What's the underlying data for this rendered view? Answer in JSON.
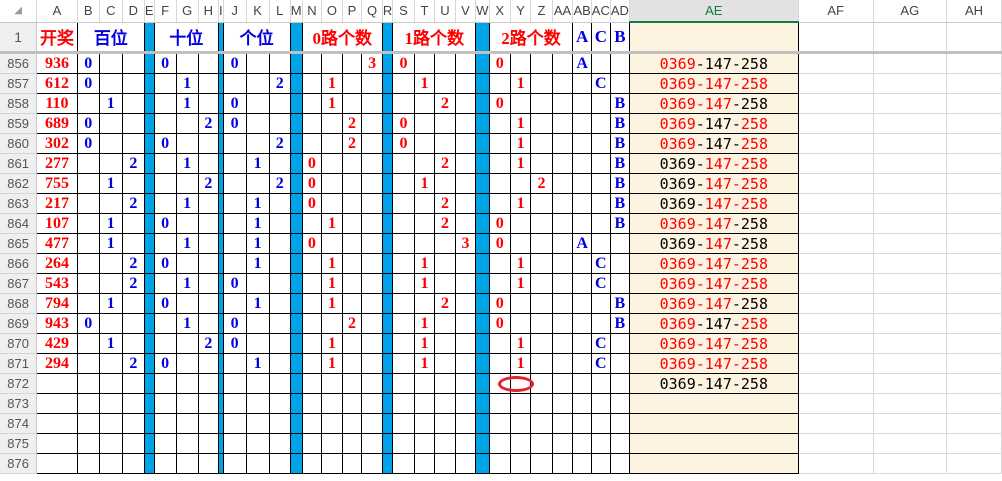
{
  "columns": [
    "A",
    "B",
    "C",
    "D",
    "E",
    "F",
    "G",
    "H",
    "I",
    "J",
    "K",
    "L",
    "M",
    "N",
    "O",
    "P",
    "Q",
    "R",
    "S",
    "T",
    "U",
    "V",
    "W",
    "X",
    "Y",
    "Z",
    "AA",
    "AB",
    "AC",
    "AD",
    "AE",
    "AF",
    "AG",
    "AH"
  ],
  "header_row": {
    "row": "1",
    "kaijiang": "开奖",
    "bai": "百位",
    "shi": "十位",
    "ge": "个位",
    "lu0": "0路个数",
    "lu1": "1路个数",
    "lu2": "2路个数",
    "ab": "A",
    "ac": "C",
    "ad": "B"
  },
  "ae_sep": "-",
  "rows": [
    {
      "row": "856",
      "a": "936",
      "cells": [
        "0",
        "",
        "",
        "0",
        "",
        "",
        "0",
        "",
        "",
        "",
        "",
        "",
        "3",
        "0",
        "",
        "",
        "",
        "0",
        "",
        "",
        "",
        "A",
        "",
        ""
      ],
      "ae_parts": [
        "0369",
        "147",
        "258"
      ],
      "ae_red": [
        1,
        0,
        0
      ]
    },
    {
      "row": "857",
      "a": "612",
      "cells": [
        "0",
        "",
        "",
        "",
        "1",
        "",
        "",
        "",
        "2",
        "",
        "1",
        "",
        "",
        "",
        "1",
        "",
        "",
        "",
        "1",
        "",
        "",
        "",
        "C",
        ""
      ],
      "ae_parts": [
        "0369",
        "147",
        "258"
      ],
      "ae_red": [
        1,
        1,
        1
      ]
    },
    {
      "row": "858",
      "a": "110",
      "cells": [
        "",
        "1",
        "",
        "",
        "1",
        "",
        "0",
        "",
        "",
        "",
        "1",
        "",
        "",
        "",
        "",
        "2",
        "",
        "0",
        "",
        "",
        "",
        "",
        "",
        "B"
      ],
      "ae_parts": [
        "0369",
        "147",
        "258"
      ],
      "ae_red": [
        1,
        1,
        0
      ]
    },
    {
      "row": "859",
      "a": "689",
      "cells": [
        "0",
        "",
        "",
        "",
        "",
        "2",
        "0",
        "",
        "",
        "",
        "",
        "2",
        "",
        "0",
        "",
        "",
        "",
        "",
        "1",
        "",
        "",
        "",
        "",
        "B"
      ],
      "ae_parts": [
        "0369",
        "147",
        "258"
      ],
      "ae_red": [
        1,
        0,
        1
      ]
    },
    {
      "row": "860",
      "a": "302",
      "cells": [
        "0",
        "",
        "",
        "0",
        "",
        "",
        "",
        "",
        "2",
        "",
        "",
        "2",
        "",
        "0",
        "",
        "",
        "",
        "",
        "1",
        "",
        "",
        "",
        "",
        "B"
      ],
      "ae_parts": [
        "0369",
        "147",
        "258"
      ],
      "ae_red": [
        1,
        0,
        1
      ]
    },
    {
      "row": "861",
      "a": "277",
      "cells": [
        "",
        "",
        "2",
        "",
        "1",
        "",
        "",
        "1",
        "",
        "0",
        "",
        "",
        "",
        "",
        "",
        "2",
        "",
        "",
        "1",
        "",
        "",
        "",
        "",
        "B"
      ],
      "ae_parts": [
        "0369",
        "147",
        "258"
      ],
      "ae_red": [
        0,
        1,
        1
      ]
    },
    {
      "row": "862",
      "a": "755",
      "cells": [
        "",
        "1",
        "",
        "",
        "",
        "2",
        "",
        "",
        "2",
        "0",
        "",
        "",
        "",
        "",
        "1",
        "",
        "",
        "",
        "",
        "2",
        "",
        "",
        "",
        "B"
      ],
      "ae_parts": [
        "0369",
        "147",
        "258"
      ],
      "ae_red": [
        0,
        1,
        1
      ]
    },
    {
      "row": "863",
      "a": "217",
      "cells": [
        "",
        "",
        "2",
        "",
        "1",
        "",
        "",
        "1",
        "",
        "0",
        "",
        "",
        "",
        "",
        "",
        "2",
        "",
        "",
        "1",
        "",
        "",
        "",
        "",
        "B"
      ],
      "ae_parts": [
        "0369",
        "147",
        "258"
      ],
      "ae_red": [
        0,
        1,
        1
      ]
    },
    {
      "row": "864",
      "a": "107",
      "cells": [
        "",
        "1",
        "",
        "0",
        "",
        "",
        "",
        "1",
        "",
        "",
        "1",
        "",
        "",
        "",
        "",
        "2",
        "",
        "0",
        "",
        "",
        "",
        "",
        "",
        "B"
      ],
      "ae_parts": [
        "0369",
        "147",
        "258"
      ],
      "ae_red": [
        1,
        1,
        0
      ]
    },
    {
      "row": "865",
      "a": "477",
      "cells": [
        "",
        "1",
        "",
        "",
        "1",
        "",
        "",
        "1",
        "",
        "0",
        "",
        "",
        "",
        "",
        "",
        "",
        "3",
        "0",
        "",
        "",
        "",
        "A",
        "",
        ""
      ],
      "ae_parts": [
        "0369",
        "147",
        "258"
      ],
      "ae_red": [
        0,
        1,
        0
      ]
    },
    {
      "row": "866",
      "a": "264",
      "cells": [
        "",
        "",
        "2",
        "0",
        "",
        "",
        "",
        "1",
        "",
        "",
        "1",
        "",
        "",
        "",
        "1",
        "",
        "",
        "",
        "1",
        "",
        "",
        "",
        "C",
        ""
      ],
      "ae_parts": [
        "0369",
        "147",
        "258"
      ],
      "ae_red": [
        1,
        1,
        1
      ]
    },
    {
      "row": "867",
      "a": "543",
      "cells": [
        "",
        "",
        "2",
        "",
        "1",
        "",
        "0",
        "",
        "",
        "",
        "1",
        "",
        "",
        "",
        "1",
        "",
        "",
        "",
        "1",
        "",
        "",
        "",
        "C",
        ""
      ],
      "ae_parts": [
        "0369",
        "147",
        "258"
      ],
      "ae_red": [
        1,
        1,
        1
      ]
    },
    {
      "row": "868",
      "a": "794",
      "cells": [
        "",
        "1",
        "",
        "0",
        "",
        "",
        "",
        "1",
        "",
        "",
        "1",
        "",
        "",
        "",
        "",
        "2",
        "",
        "0",
        "",
        "",
        "",
        "",
        "",
        "B"
      ],
      "ae_parts": [
        "0369",
        "147",
        "258"
      ],
      "ae_red": [
        1,
        1,
        0
      ]
    },
    {
      "row": "869",
      "a": "943",
      "cells": [
        "0",
        "",
        "",
        "",
        "1",
        "",
        "0",
        "",
        "",
        "",
        "",
        "2",
        "",
        "",
        "1",
        "",
        "",
        "0",
        "",
        "",
        "",
        "",
        "",
        "B"
      ],
      "ae_parts": [
        "0369",
        "147",
        "258"
      ],
      "ae_red": [
        1,
        0,
        1
      ]
    },
    {
      "row": "870",
      "a": "429",
      "cells": [
        "",
        "1",
        "",
        "",
        "",
        "2",
        "0",
        "",
        "",
        "",
        "1",
        "",
        "",
        "",
        "1",
        "",
        "",
        "",
        "1",
        "",
        "",
        "",
        "C",
        ""
      ],
      "ae_parts": [
        "0369",
        "147",
        "258"
      ],
      "ae_red": [
        1,
        1,
        1
      ]
    },
    {
      "row": "871",
      "a": "294",
      "cells": [
        "",
        "",
        "2",
        "0",
        "",
        "",
        "",
        "1",
        "",
        "",
        "1",
        "",
        "",
        "",
        "1",
        "",
        "",
        "",
        "1",
        "",
        "",
        "",
        "C",
        ""
      ],
      "ae_parts": [
        "0369",
        "147",
        "258"
      ],
      "ae_red": [
        1,
        1,
        1
      ]
    },
    {
      "row": "872",
      "a": "",
      "cells": [
        "",
        "",
        "",
        "",
        "",
        "",
        "",
        "",
        "",
        "",
        "",
        "",
        "",
        "",
        "",
        "",
        "",
        "",
        "",
        "",
        "",
        "",
        "",
        ""
      ],
      "ae_parts": [
        "0369",
        "147",
        "258"
      ],
      "ae_red": [
        0,
        0,
        0
      ]
    },
    {
      "row": "873",
      "a": "",
      "cells": [],
      "ae_parts": [],
      "ae_red": []
    },
    {
      "row": "874",
      "a": "",
      "cells": [],
      "ae_parts": [],
      "ae_red": []
    },
    {
      "row": "875",
      "a": "",
      "cells": [],
      "ae_parts": [],
      "ae_red": []
    },
    {
      "row": "876",
      "a": "",
      "cells": [],
      "ae_parts": [],
      "ae_red": []
    }
  ],
  "colors": {
    "red": "#ff0000",
    "blue": "#0000e0",
    "separator": "#00a2e8",
    "ae_bg": "#fdf3e1",
    "marker": "#e8202a"
  }
}
